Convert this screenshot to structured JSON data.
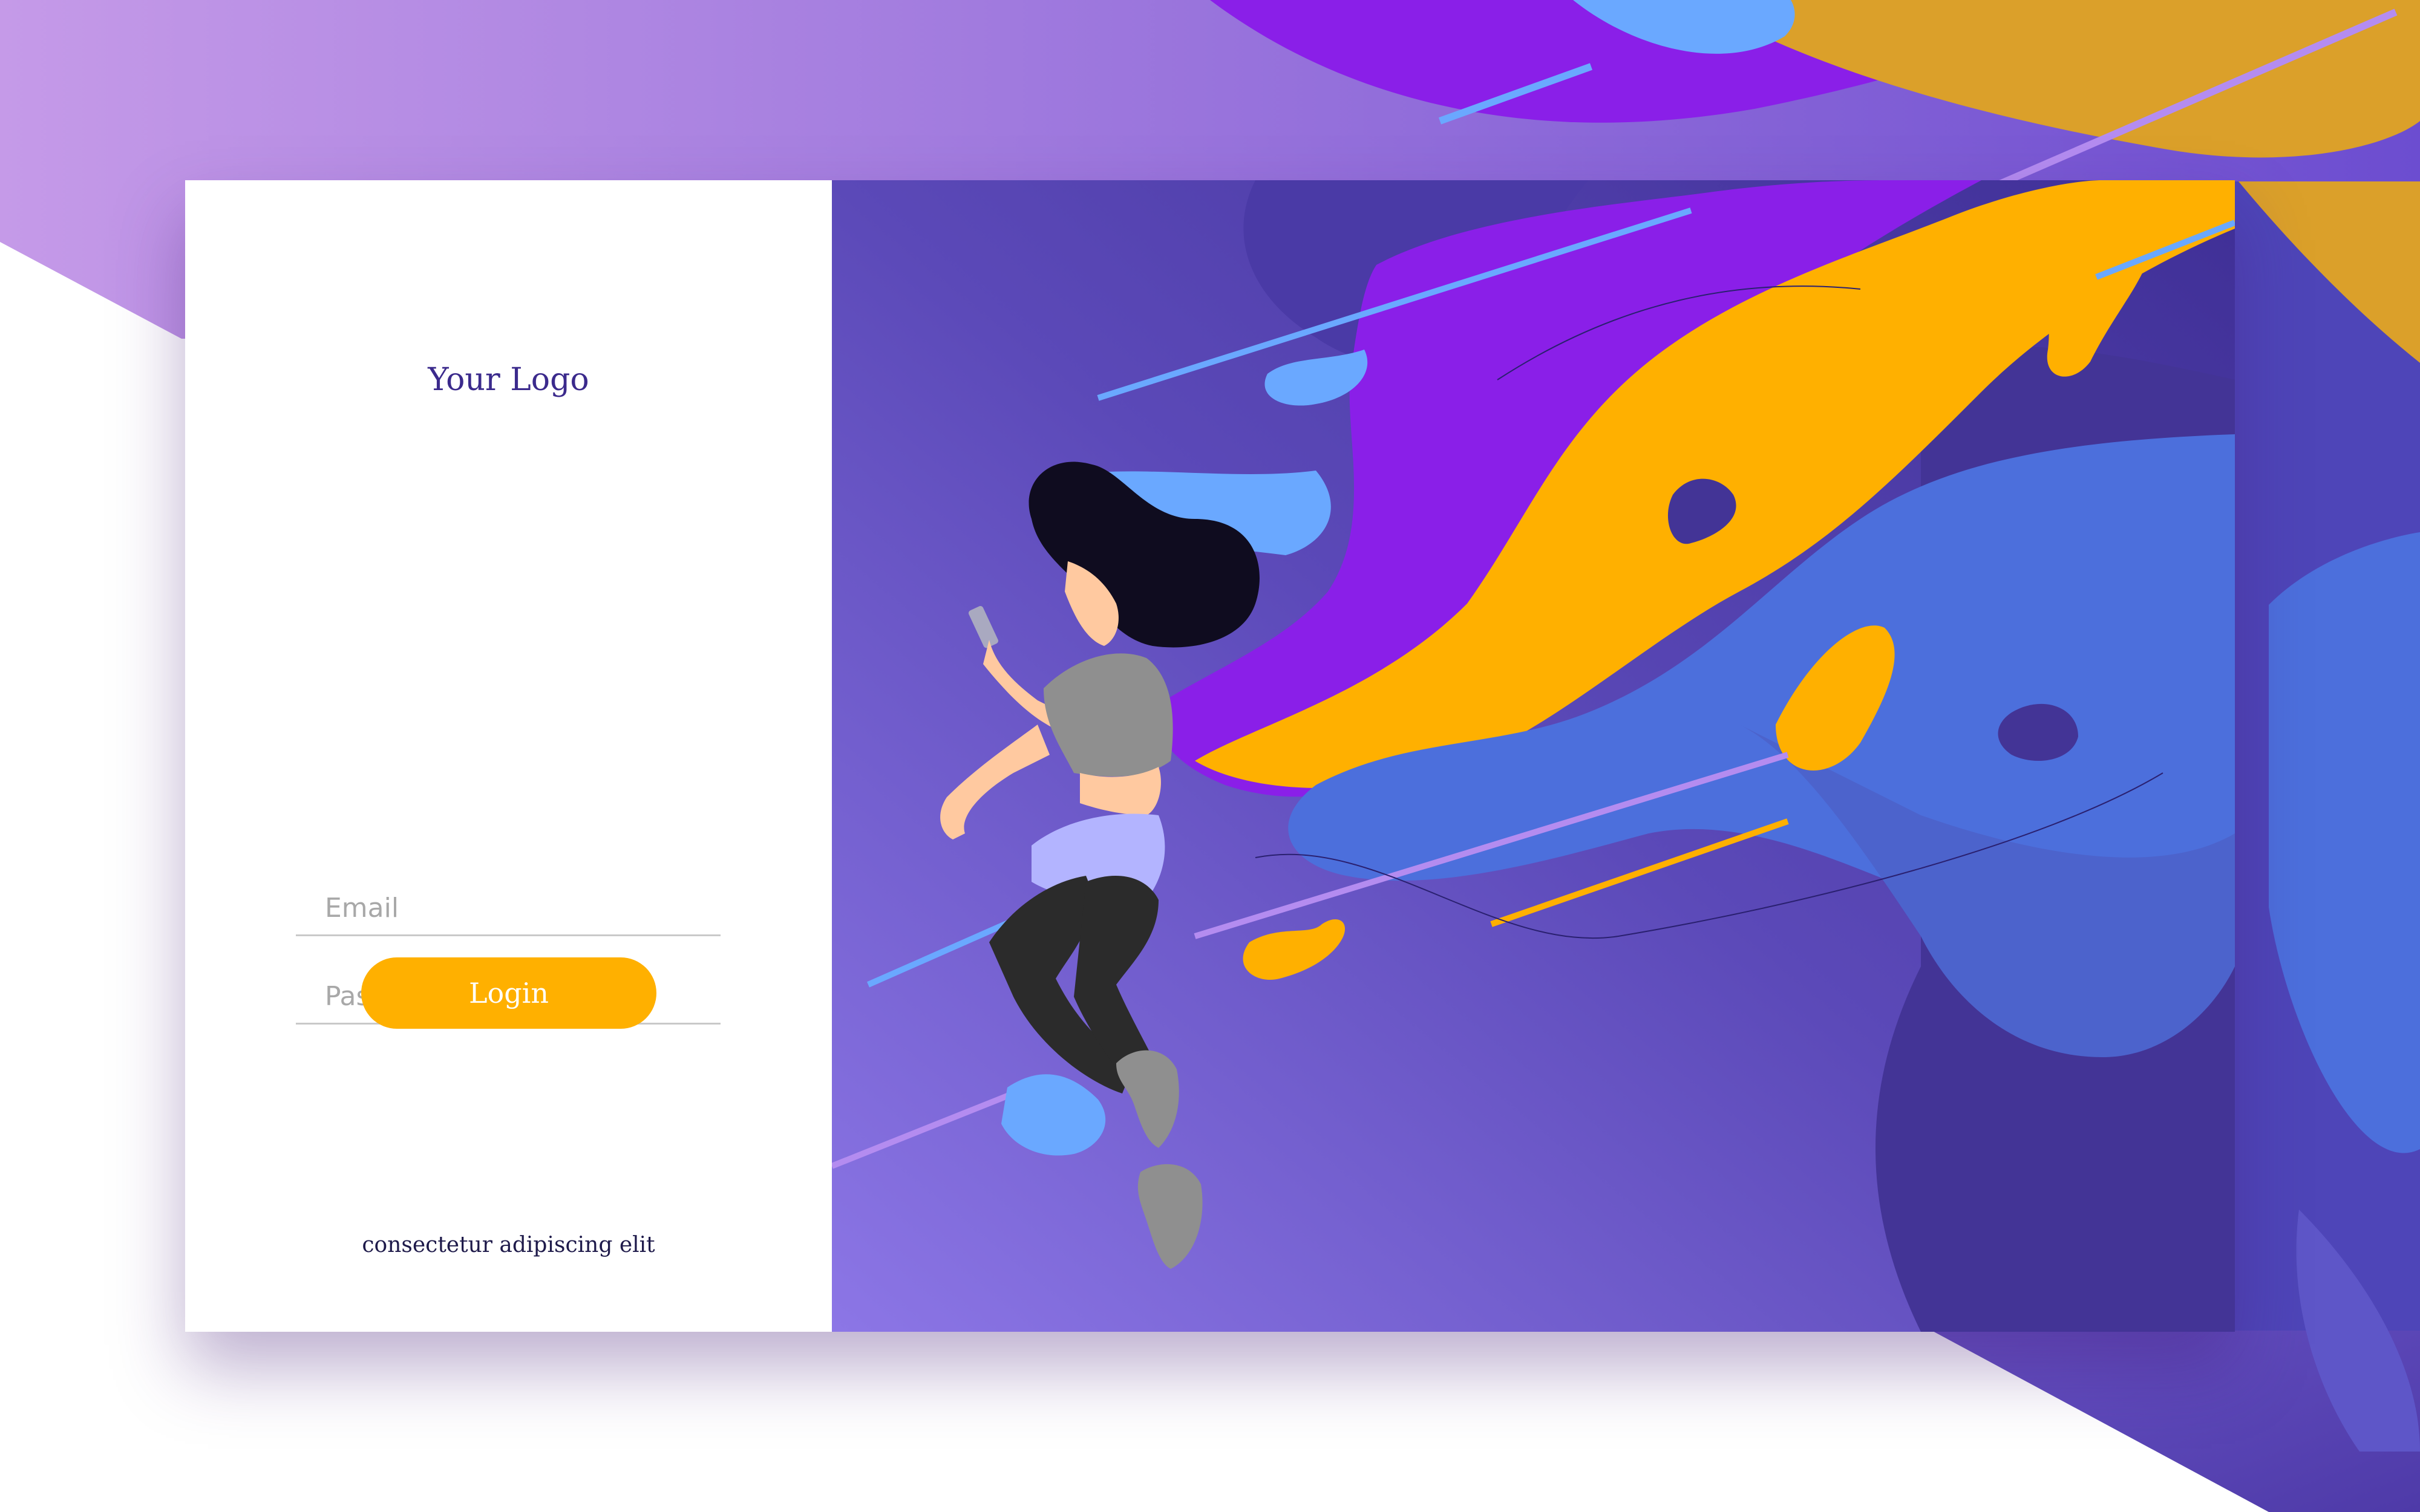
{
  "login_panel": {
    "logo_text": "Your Logo",
    "email_placeholder": "Email",
    "password_placeholder": "Password",
    "login_label": "Login",
    "footer_text": "consectetur adipiscing elit"
  },
  "theme": {
    "accent": "#ffb000",
    "purple": "#8a1fe8",
    "indigo": "#4a3ba8",
    "blue": "#4c6fdc",
    "light_blue": "#6aa8ff",
    "logo_color": "#3b2a8c"
  },
  "illustration": {
    "subject": "woman-looking-at-phone-icon",
    "background": "abstract-fluid-waves"
  }
}
